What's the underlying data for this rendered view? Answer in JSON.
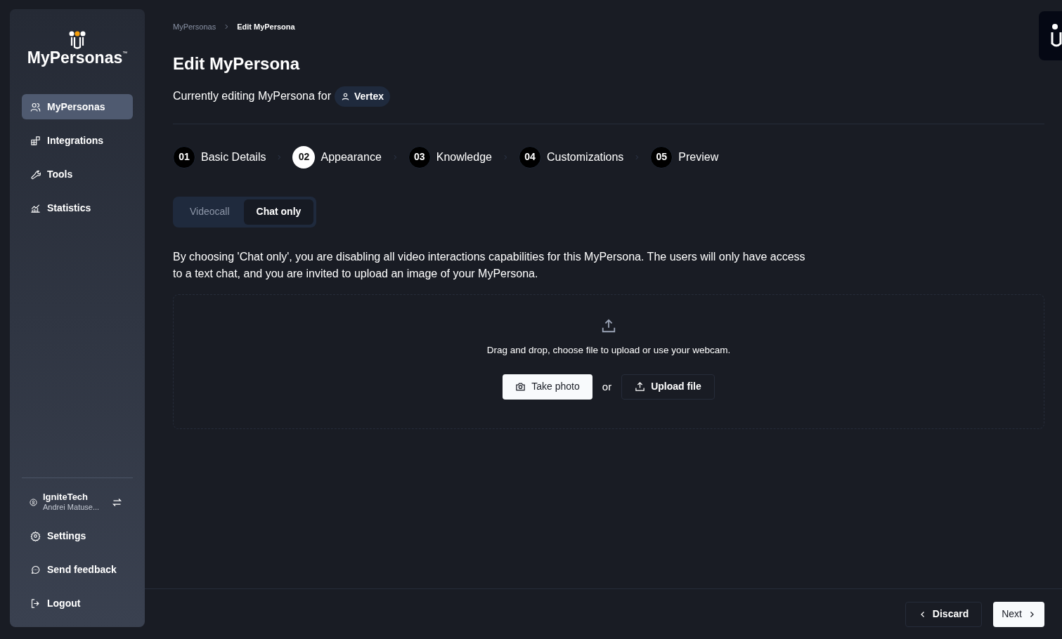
{
  "sidebar": {
    "logo": {
      "name": "MyPersonas",
      "trademark": "™"
    },
    "nav": [
      {
        "label": "MyPersonas",
        "kind": "users",
        "selected": true
      },
      {
        "label": "Integrations",
        "kind": "blocks",
        "selected": false
      },
      {
        "label": "Tools",
        "kind": "wrench",
        "selected": false
      },
      {
        "label": "Statistics",
        "kind": "chart",
        "selected": false
      }
    ],
    "account": {
      "org": "IgniteTech",
      "user": "Andrei Matuse..."
    },
    "bottom": [
      {
        "label": "Settings",
        "kind": "gear"
      },
      {
        "label": "Send feedback",
        "kind": "chat"
      },
      {
        "label": "Logout",
        "kind": "logout"
      }
    ]
  },
  "breadcrumb": [
    "MyPersonas",
    "Edit MyPersona"
  ],
  "title": "Edit MyPersona",
  "subtitle": "Currently editing MyPersona for",
  "persona_chip": "Vertex",
  "steps": [
    {
      "number": "01",
      "label": "Basic Details",
      "selected": false
    },
    {
      "number": "02",
      "label": "Appearance",
      "selected": true
    },
    {
      "number": "03",
      "label": "Knowledge",
      "selected": false
    },
    {
      "number": "04",
      "label": "Customizations",
      "selected": false
    },
    {
      "number": "05",
      "label": "Preview",
      "selected": false
    }
  ],
  "mode_tabs": [
    {
      "label": "Videocall",
      "selected": false
    },
    {
      "label": "Chat only",
      "selected": true
    }
  ],
  "description": "By choosing 'Chat only', you are disabling all video interactions capabilities for this MyPersona. The users will only have access to a text chat, and you are invited to upload an image of your MyPersona.",
  "upload": {
    "hint": "Drag and drop, choose file to upload or use your webcam.",
    "take_photo": "Take photo",
    "or": "or",
    "upload_file": "Upload file"
  },
  "footer": {
    "discard": "Discard",
    "next": "Next"
  }
}
